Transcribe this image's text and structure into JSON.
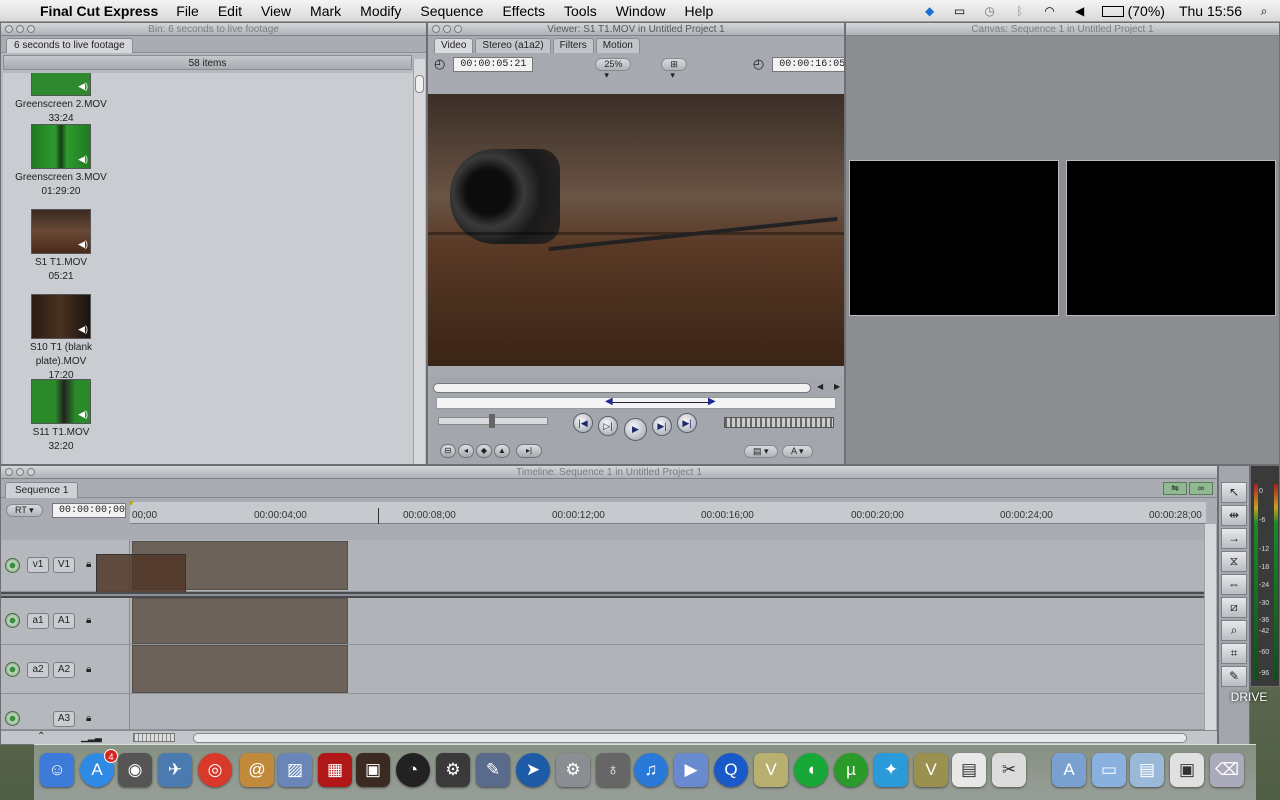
{
  "menubar": {
    "app_name": "Final Cut Express",
    "menus": [
      "File",
      "Edit",
      "View",
      "Mark",
      "Modify",
      "Sequence",
      "Effects",
      "Tools",
      "Window",
      "Help"
    ],
    "battery": "(70%)",
    "clock": "Thu 15:56"
  },
  "browser": {
    "title": "Bin: 6 seconds to live footage",
    "tab": "6 seconds to live footage",
    "count": "58 items",
    "clips": [
      {
        "name": "Greenscreen 2.MOV",
        "duration": "33:24"
      },
      {
        "name": "Greenscreen 3.MOV",
        "duration": "01:29:20"
      },
      {
        "name": "S1 T1.MOV",
        "duration": "05:21"
      },
      {
        "name": "S10 T1 (blank plate).MOV",
        "duration": "17:20"
      },
      {
        "name": "S11 T1.MOV",
        "duration": "32:20"
      }
    ]
  },
  "viewer": {
    "title": "Viewer: S1 T1.MOV in Untitled Project 1",
    "tabs": [
      "Video",
      "Stereo (a1a2)",
      "Filters",
      "Motion"
    ],
    "timecode_duration": "00:00:05:21",
    "zoom": "25%",
    "timecode_current": "00:00:16:05"
  },
  "canvas": {
    "title": "Canvas: Sequence 1 in Untitled Project 1"
  },
  "timeline": {
    "title": "Timeline: Sequence 1 in Untitled Project 1",
    "sequence_tab": "Sequence 1",
    "rt_label": "RT",
    "current_timecode": "00:00:00;00",
    "ruler_ticks": [
      "00;00",
      "00:00:04;00",
      "00:00:08;00",
      "00:00:12;00",
      "00:00:16;00",
      "00:00:20;00",
      "00:00:24;00",
      "00:00:28;00"
    ],
    "tracks": [
      {
        "source": "v1",
        "dest": "V1"
      },
      {
        "source": "a1",
        "dest": "A1"
      },
      {
        "source": "a2",
        "dest": "A2"
      },
      {
        "source": "",
        "dest": "A3"
      }
    ]
  },
  "audio_meters": {
    "ticks": [
      "0",
      "-6",
      "-12",
      "-18",
      "-24",
      "-30",
      "-36",
      "-42",
      "-60",
      "-96"
    ]
  },
  "desktop": {
    "drive_label": "DRIVE"
  },
  "dock": {
    "app_store_badge": "4"
  },
  "colors": {
    "accent": "#1b8a2a",
    "video_bg": "#5a3a26",
    "clip_block": "#6d6259"
  }
}
